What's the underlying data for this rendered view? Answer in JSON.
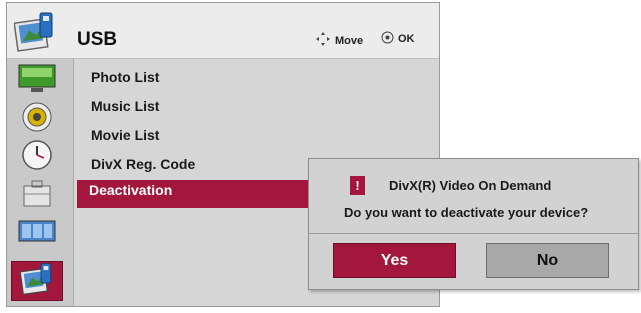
{
  "header": {
    "title": "USB",
    "icon": "photo-usb-icon",
    "hints": {
      "move_label": "Move",
      "ok_label": "OK",
      "move_icon": "dpad-arrows-icon",
      "ok_icon": "ok-circle-icon"
    }
  },
  "sidebar": {
    "items": [
      {
        "icon": "tv-picture-icon"
      },
      {
        "icon": "speaker-audio-icon"
      },
      {
        "icon": "clock-time-icon"
      },
      {
        "icon": "toolbox-option-icon"
      },
      {
        "icon": "input-screens-icon"
      },
      {
        "icon": "photo-usb-icon",
        "active": true
      }
    ]
  },
  "menu": {
    "items": [
      {
        "label": "Photo List"
      },
      {
        "label": "Music List"
      },
      {
        "label": "Movie List"
      },
      {
        "label": "DivX Reg. Code"
      },
      {
        "label": "Deactivation",
        "selected": true
      }
    ]
  },
  "dialog": {
    "warning_symbol": "!",
    "title": "DivX(R) Video On Demand",
    "question": "Do you want to deactivate your device?",
    "yes_label": "Yes",
    "no_label": "No"
  },
  "colors": {
    "accent": "#a3173d",
    "panel": "#d6d6d6",
    "header": "#ececec"
  }
}
